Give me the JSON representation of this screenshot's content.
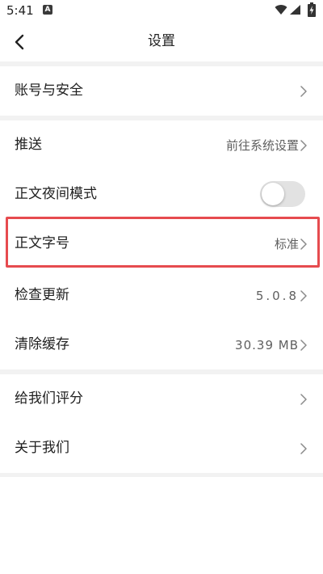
{
  "status_bar": {
    "time": "5:41",
    "notification_glyph": "A",
    "icons": [
      "wifi-icon",
      "signal-icon",
      "battery-charging-icon"
    ]
  },
  "header": {
    "title": "设置",
    "back_icon": "chevron-left-icon"
  },
  "sections": [
    {
      "rows": [
        {
          "label": "账号与安全",
          "value": "",
          "control": "chevron"
        }
      ]
    },
    {
      "rows": [
        {
          "label": "推送",
          "value": "前往系统设置",
          "control": "chevron"
        },
        {
          "label": "正文夜间模式",
          "value": "",
          "control": "toggle",
          "toggle_on": false
        },
        {
          "label": "正文字号",
          "value": "标准",
          "control": "chevron",
          "highlighted": true
        },
        {
          "label": "检查更新",
          "value": "5.0.8",
          "control": "chevron"
        },
        {
          "label": "清除缓存",
          "value": "30.39 MB",
          "control": "chevron"
        }
      ]
    },
    {
      "rows": [
        {
          "label": "给我们评分",
          "value": "",
          "control": "chevron"
        },
        {
          "label": "关于我们",
          "value": "",
          "control": "chevron"
        }
      ]
    }
  ],
  "colors": {
    "background": "#ffffff",
    "section_gap": "#f2f2f2",
    "highlight_border": "#e64b4f",
    "toggle_off": "#e2e2e2",
    "secondary_text": "#5f5f5f"
  }
}
